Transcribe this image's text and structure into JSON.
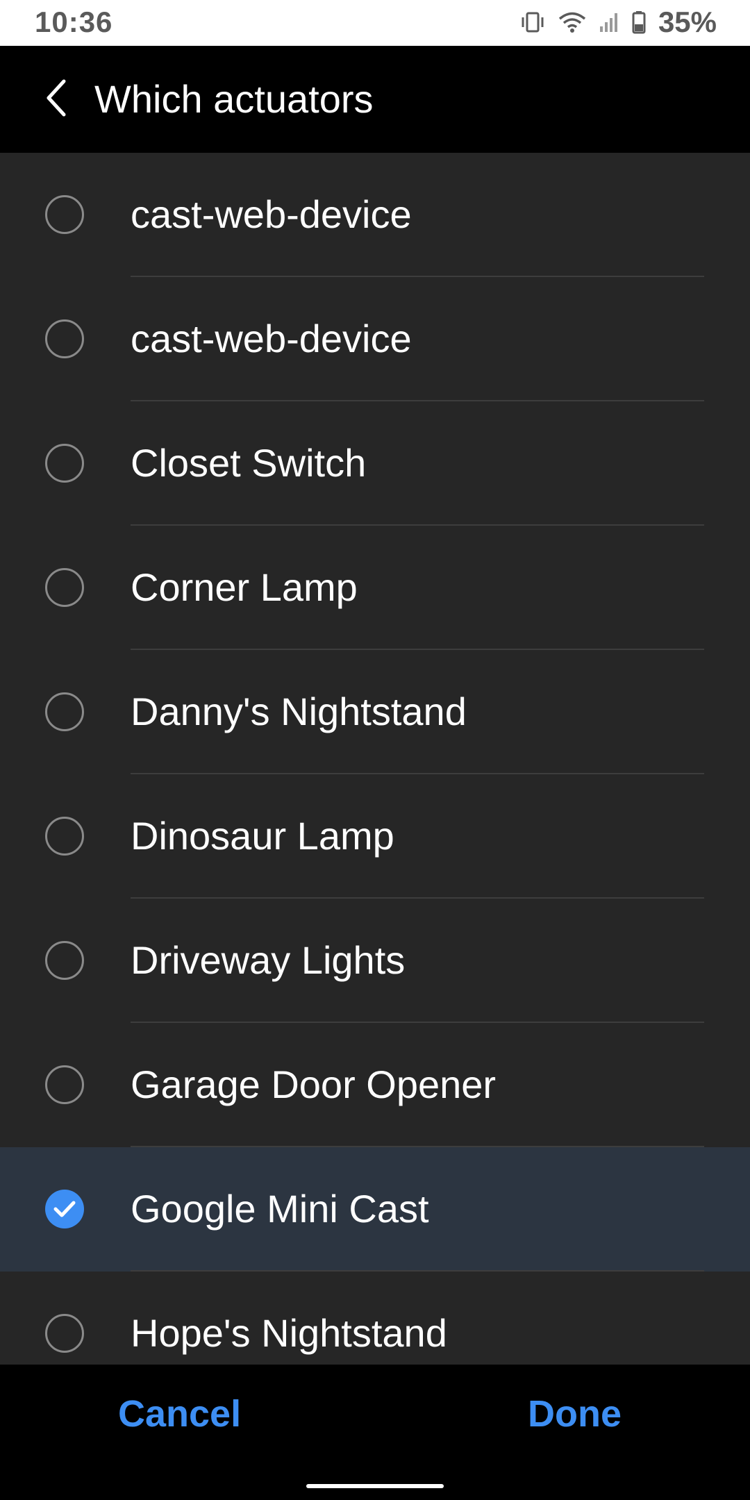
{
  "status_bar": {
    "time": "10:36",
    "battery": "35%",
    "icons": [
      "vibrate-icon",
      "wifi-icon",
      "cell-signal-icon",
      "battery-icon"
    ]
  },
  "app_bar": {
    "title": "Which actuators",
    "back_icon": "chevron-left-icon"
  },
  "list": {
    "items": [
      {
        "label": "cast-web-device",
        "selected": false
      },
      {
        "label": "cast-web-device",
        "selected": false
      },
      {
        "label": "Closet Switch",
        "selected": false
      },
      {
        "label": "Corner Lamp",
        "selected": false
      },
      {
        "label": "Danny's Nightstand",
        "selected": false
      },
      {
        "label": "Dinosaur Lamp",
        "selected": false
      },
      {
        "label": "Driveway Lights",
        "selected": false
      },
      {
        "label": "Garage Door Opener",
        "selected": false
      },
      {
        "label": "Google Mini Cast",
        "selected": true
      },
      {
        "label": "Hope's Nightstand",
        "selected": false
      }
    ]
  },
  "footer": {
    "cancel_label": "Cancel",
    "done_label": "Done"
  },
  "colors": {
    "accent": "#3d8ef3",
    "list_background": "#262626",
    "selected_row": "#2c3541",
    "bar_background": "#000000"
  }
}
